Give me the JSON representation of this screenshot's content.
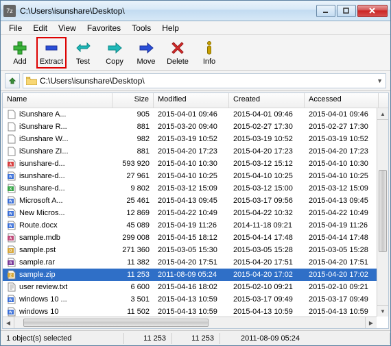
{
  "window": {
    "title": "C:\\Users\\isunshare\\Desktop\\",
    "app_icon_label": "7z"
  },
  "menu": [
    "File",
    "Edit",
    "View",
    "Favorites",
    "Tools",
    "Help"
  ],
  "toolbar": [
    {
      "label": "Add",
      "icon": "plus"
    },
    {
      "label": "Extract",
      "icon": "minus"
    },
    {
      "label": "Test",
      "icon": "check-right"
    },
    {
      "label": "Copy",
      "icon": "arrow-right-teal"
    },
    {
      "label": "Move",
      "icon": "arrow-right-blue"
    },
    {
      "label": "Delete",
      "icon": "x"
    },
    {
      "label": "Info",
      "icon": "info"
    }
  ],
  "address": {
    "path": "C:\\Users\\isunshare\\Desktop\\"
  },
  "columns": [
    "Name",
    "Size",
    "Modified",
    "Created",
    "Accessed"
  ],
  "files": [
    {
      "name": "iSunshare A...",
      "size": "905",
      "mod": "2015-04-01 09:46",
      "crt": "2015-04-01 09:46",
      "acc": "2015-04-01 09:46",
      "ico": "file"
    },
    {
      "name": "iSunshare R...",
      "size": "881",
      "mod": "2015-03-20 09:40",
      "crt": "2015-02-27 17:30",
      "acc": "2015-02-27 17:30",
      "ico": "file"
    },
    {
      "name": "iSunshare W...",
      "size": "982",
      "mod": "2015-03-19 10:52",
      "crt": "2015-03-19 10:52",
      "acc": "2015-03-19 10:52",
      "ico": "file"
    },
    {
      "name": "iSunshare ZI...",
      "size": "881",
      "mod": "2015-04-20 17:23",
      "crt": "2015-04-20 17:23",
      "acc": "2015-04-20 17:23",
      "ico": "file"
    },
    {
      "name": "isunshare-d...",
      "size": "593 920",
      "mod": "2015-04-10 10:30",
      "crt": "2015-03-12 15:12",
      "acc": "2015-04-10 10:30",
      "ico": "pdf"
    },
    {
      "name": "isunshare-d...",
      "size": "27 961",
      "mod": "2015-04-10 10:25",
      "crt": "2015-04-10 10:25",
      "acc": "2015-04-10 10:25",
      "ico": "word"
    },
    {
      "name": "isunshare-d...",
      "size": "9 802",
      "mod": "2015-03-12 15:09",
      "crt": "2015-03-12 15:00",
      "acc": "2015-03-12 15:09",
      "ico": "excel"
    },
    {
      "name": "Microsoft A...",
      "size": "25 461",
      "mod": "2015-04-13 09:45",
      "crt": "2015-03-17 09:56",
      "acc": "2015-04-13 09:45",
      "ico": "word"
    },
    {
      "name": "New Micros...",
      "size": "12 869",
      "mod": "2015-04-22 10:49",
      "crt": "2015-04-22 10:32",
      "acc": "2015-04-22 10:49",
      "ico": "word"
    },
    {
      "name": "Route.docx",
      "size": "45 089",
      "mod": "2015-04-19 11:26",
      "crt": "2014-11-18 09:21",
      "acc": "2015-04-19 11:26",
      "ico": "word"
    },
    {
      "name": "sample.mdb",
      "size": "299 008",
      "mod": "2015-04-15 18:12",
      "crt": "2015-04-14 17:48",
      "acc": "2015-04-14 17:48",
      "ico": "access"
    },
    {
      "name": "sample.pst",
      "size": "271 360",
      "mod": "2015-03-05 15:30",
      "crt": "2015-03-05 15:28",
      "acc": "2015-03-05 15:28",
      "ico": "outlook"
    },
    {
      "name": "sample.rar",
      "size": "11 382",
      "mod": "2015-04-20 17:51",
      "crt": "2015-04-20 17:51",
      "acc": "2015-04-20 17:51",
      "ico": "rar"
    },
    {
      "name": "sample.zip",
      "size": "11 253",
      "mod": "2011-08-09 05:24",
      "crt": "2015-04-20 17:02",
      "acc": "2015-04-20 17:02",
      "ico": "zip",
      "selected": true
    },
    {
      "name": "user review.txt",
      "size": "6 600",
      "mod": "2015-04-16 18:02",
      "crt": "2015-02-10 09:21",
      "acc": "2015-02-10 09:21",
      "ico": "txt"
    },
    {
      "name": "windows 10 ...",
      "size": "3 501",
      "mod": "2015-04-13 10:59",
      "crt": "2015-03-17 09:49",
      "acc": "2015-03-17 09:49",
      "ico": "word"
    },
    {
      "name": "windows 10",
      "size": "11 502",
      "mod": "2015-04-13 10:59",
      "crt": "2015-04-13 10:59",
      "acc": "2015-04-13 10:59",
      "ico": "word"
    }
  ],
  "status": {
    "selection": "1 object(s) selected",
    "size1": "11 253",
    "size2": "11 253",
    "date": "2011-08-09 05:24"
  }
}
